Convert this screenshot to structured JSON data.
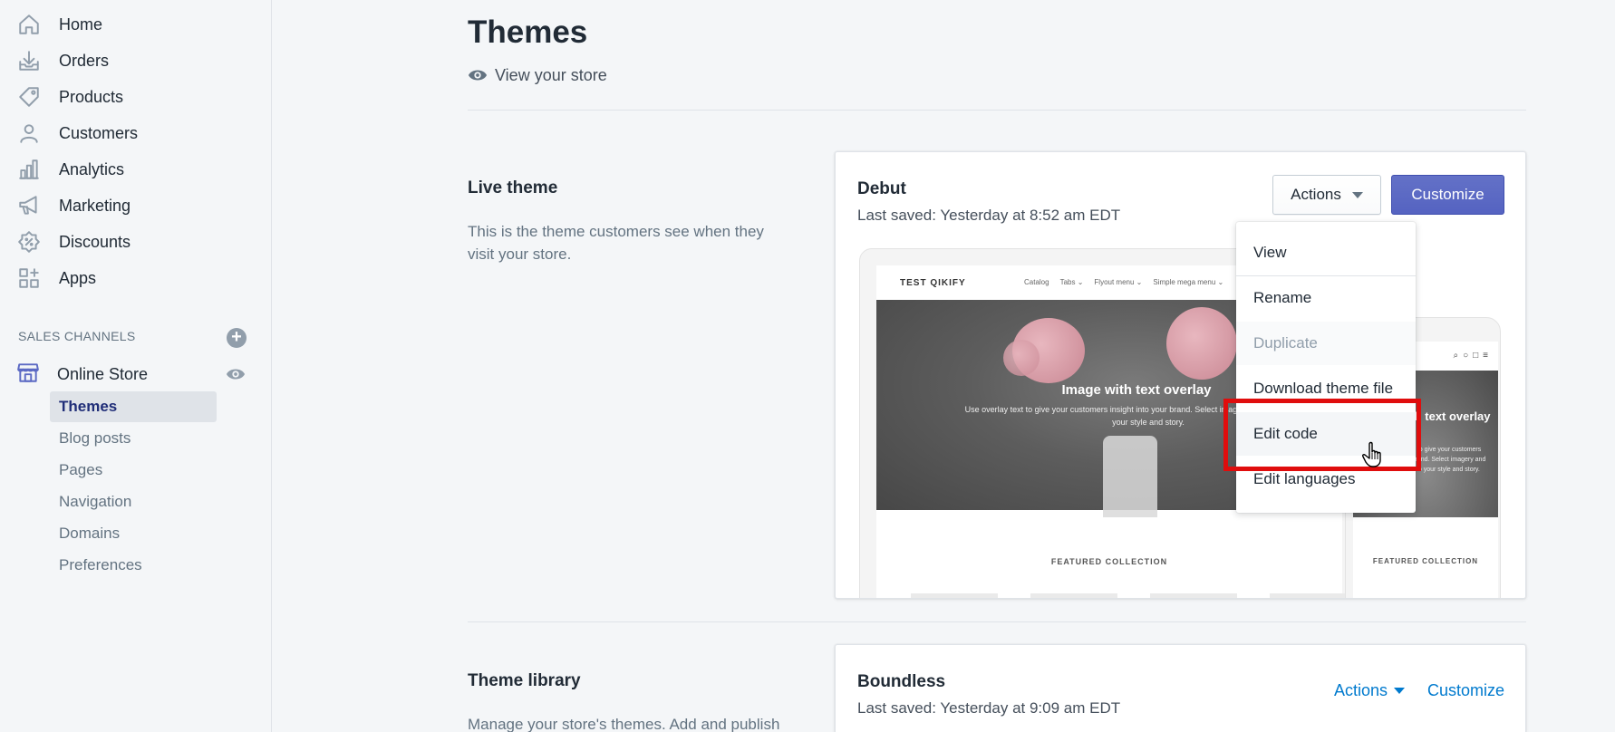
{
  "sidebar": {
    "nav": [
      {
        "label": "Home",
        "icon": "home-icon"
      },
      {
        "label": "Orders",
        "icon": "orders-icon"
      },
      {
        "label": "Products",
        "icon": "tag-icon"
      },
      {
        "label": "Customers",
        "icon": "person-icon"
      },
      {
        "label": "Analytics",
        "icon": "bar-chart-icon"
      },
      {
        "label": "Marketing",
        "icon": "megaphone-icon"
      },
      {
        "label": "Discounts",
        "icon": "discount-badge-icon"
      },
      {
        "label": "Apps",
        "icon": "apps-grid-icon"
      }
    ],
    "sales_channels_header": "SALES CHANNELS",
    "online_store": "Online Store",
    "sub_items": [
      "Themes",
      "Blog posts",
      "Pages",
      "Navigation",
      "Domains",
      "Preferences"
    ],
    "active_sub_item": "Themes"
  },
  "page": {
    "title": "Themes",
    "view_store": "View your store"
  },
  "live_theme": {
    "section_title": "Live theme",
    "section_desc": "This is the theme customers see when they visit your store.",
    "theme_name": "Debut",
    "last_saved": "Last saved: Yesterday at 8:52 am EDT",
    "actions_label": "Actions",
    "customize_label": "Customize",
    "preview": {
      "store_name": "TEST QIKIFY",
      "nav_items": [
        "Catalog",
        "Tabs ⌄",
        "Flyout menu ⌄",
        "Simple mega menu ⌄"
      ],
      "hero_title": "Image with text overlay",
      "hero_text": "Use overlay text to give your customers insight into your brand. Select imagery and text that relates to your style and story.",
      "featured": "FEATURED COLLECTION",
      "mobile_hero_title": "Image with text overlay",
      "mobile_hero_text": "Use overlay text to give your customers insight into your brand. Select imagery and text that relates to your style and story.",
      "mobile_featured": "FEATURED COLLECTION"
    }
  },
  "actions_menu": {
    "items": [
      {
        "label": "View",
        "state": "normal"
      },
      {
        "label": "Rename",
        "state": "normal"
      },
      {
        "label": "Duplicate",
        "state": "disabled"
      },
      {
        "label": "Download theme file",
        "state": "normal"
      },
      {
        "label": "Edit code",
        "state": "hover"
      },
      {
        "label": "Edit languages",
        "state": "normal"
      }
    ],
    "highlight_color": "#e00d0d"
  },
  "theme_library": {
    "section_title": "Theme library",
    "section_desc": "Manage your store's themes. Add and publish",
    "theme_name": "Boundless",
    "last_saved": "Last saved: Yesterday at 9:09 am EDT",
    "actions_label": "Actions",
    "customize_label": "Customize"
  },
  "colors": {
    "primary": "#5c6ac4",
    "link": "#007ace",
    "text": "#212b36",
    "subdued": "#637381"
  }
}
